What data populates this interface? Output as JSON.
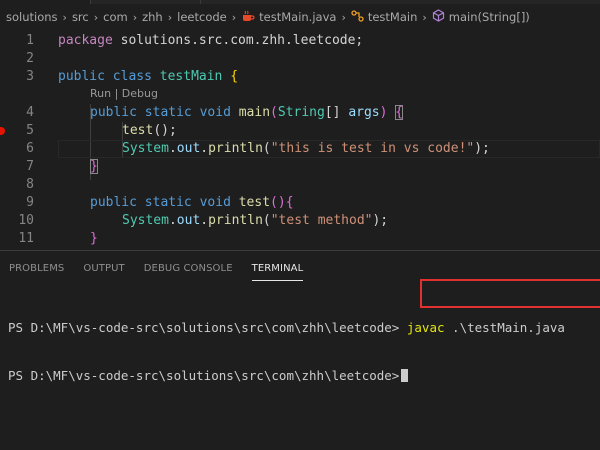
{
  "breadcrumb": {
    "items": [
      "solutions",
      "src",
      "com",
      "zhh",
      "leetcode",
      "testMain.java",
      "testMain",
      "main(String[])"
    ],
    "separator": "›"
  },
  "editor": {
    "codelens": "Run | Debug",
    "lines": [
      {
        "n": "1",
        "tokens": [
          {
            "t": "package",
            "c": "kw"
          },
          {
            "t": " solutions.src.com.zhh.leetcode;",
            "c": "plain"
          }
        ]
      },
      {
        "n": "2",
        "tokens": []
      },
      {
        "n": "3",
        "tokens": [
          {
            "t": "public",
            "c": "kw2"
          },
          {
            "t": " ",
            "c": "plain"
          },
          {
            "t": "class",
            "c": "kw2"
          },
          {
            "t": " ",
            "c": "plain"
          },
          {
            "t": "testMain",
            "c": "cls"
          },
          {
            "t": " ",
            "c": "plain"
          },
          {
            "t": "{",
            "c": "brace-gold"
          }
        ]
      },
      {
        "n": "4",
        "tokens": [
          {
            "t": "public",
            "c": "kw2"
          },
          {
            "t": " ",
            "c": "plain"
          },
          {
            "t": "static",
            "c": "kw2"
          },
          {
            "t": " ",
            "c": "plain"
          },
          {
            "t": "void",
            "c": "kw2"
          },
          {
            "t": " ",
            "c": "plain"
          },
          {
            "t": "main",
            "c": "fn"
          },
          {
            "t": "(",
            "c": "brace-pink"
          },
          {
            "t": "String",
            "c": "cls"
          },
          {
            "t": "[]",
            "c": "plain"
          },
          {
            "t": " ",
            "c": "plain"
          },
          {
            "t": "args",
            "c": "var"
          },
          {
            "t": ")",
            "c": "brace-pink"
          },
          {
            "t": " ",
            "c": "plain"
          },
          {
            "t": "{",
            "c": "brace-pink bracket-match"
          }
        ]
      },
      {
        "n": "5",
        "tokens": [
          {
            "t": "test",
            "c": "fn"
          },
          {
            "t": "();",
            "c": "plain"
          }
        ]
      },
      {
        "n": "6",
        "tokens": [
          {
            "t": "System",
            "c": "cls"
          },
          {
            "t": ".",
            "c": "plain"
          },
          {
            "t": "out",
            "c": "var"
          },
          {
            "t": ".",
            "c": "plain"
          },
          {
            "t": "println",
            "c": "fn"
          },
          {
            "t": "(",
            "c": "plain"
          },
          {
            "t": "\"this is test in vs code!\"",
            "c": "str"
          },
          {
            "t": ");",
            "c": "plain"
          }
        ]
      },
      {
        "n": "7",
        "tokens": [
          {
            "t": "}",
            "c": "brace-pink bracket-match"
          }
        ]
      },
      {
        "n": "8",
        "tokens": []
      },
      {
        "n": "9",
        "tokens": [
          {
            "t": "public",
            "c": "kw2"
          },
          {
            "t": " ",
            "c": "plain"
          },
          {
            "t": "static",
            "c": "kw2"
          },
          {
            "t": " ",
            "c": "plain"
          },
          {
            "t": "void",
            "c": "kw2"
          },
          {
            "t": " ",
            "c": "plain"
          },
          {
            "t": "test",
            "c": "fn"
          },
          {
            "t": "()",
            "c": "brace-pink"
          },
          {
            "t": "{",
            "c": "brace-pink"
          }
        ]
      },
      {
        "n": "10",
        "tokens": [
          {
            "t": "System",
            "c": "cls"
          },
          {
            "t": ".",
            "c": "plain"
          },
          {
            "t": "out",
            "c": "var"
          },
          {
            "t": ".",
            "c": "plain"
          },
          {
            "t": "println",
            "c": "fn"
          },
          {
            "t": "(",
            "c": "plain"
          },
          {
            "t": "\"test method\"",
            "c": "str"
          },
          {
            "t": ");",
            "c": "plain"
          }
        ]
      },
      {
        "n": "11",
        "tokens": [
          {
            "t": "}",
            "c": "brace-pink"
          }
        ]
      }
    ]
  },
  "panel": {
    "tabs": [
      "PROBLEMS",
      "OUTPUT",
      "DEBUG CONSOLE",
      "TERMINAL"
    ],
    "active_tab": "TERMINAL",
    "terminal": {
      "line1_prompt": "PS D:\\MF\\vs-code-src\\solutions\\src\\com\\zhh\\leetcode>",
      "line1_cmd": "javac",
      "line1_arg": " .\\testMain.java",
      "line2_prompt": "PS D:\\MF\\vs-code-src\\solutions\\src\\com\\zhh\\leetcode>"
    }
  },
  "colors": {
    "background": "#1e1e1e",
    "highlight_box": "#e03030",
    "breakpoint": "#e51400"
  }
}
